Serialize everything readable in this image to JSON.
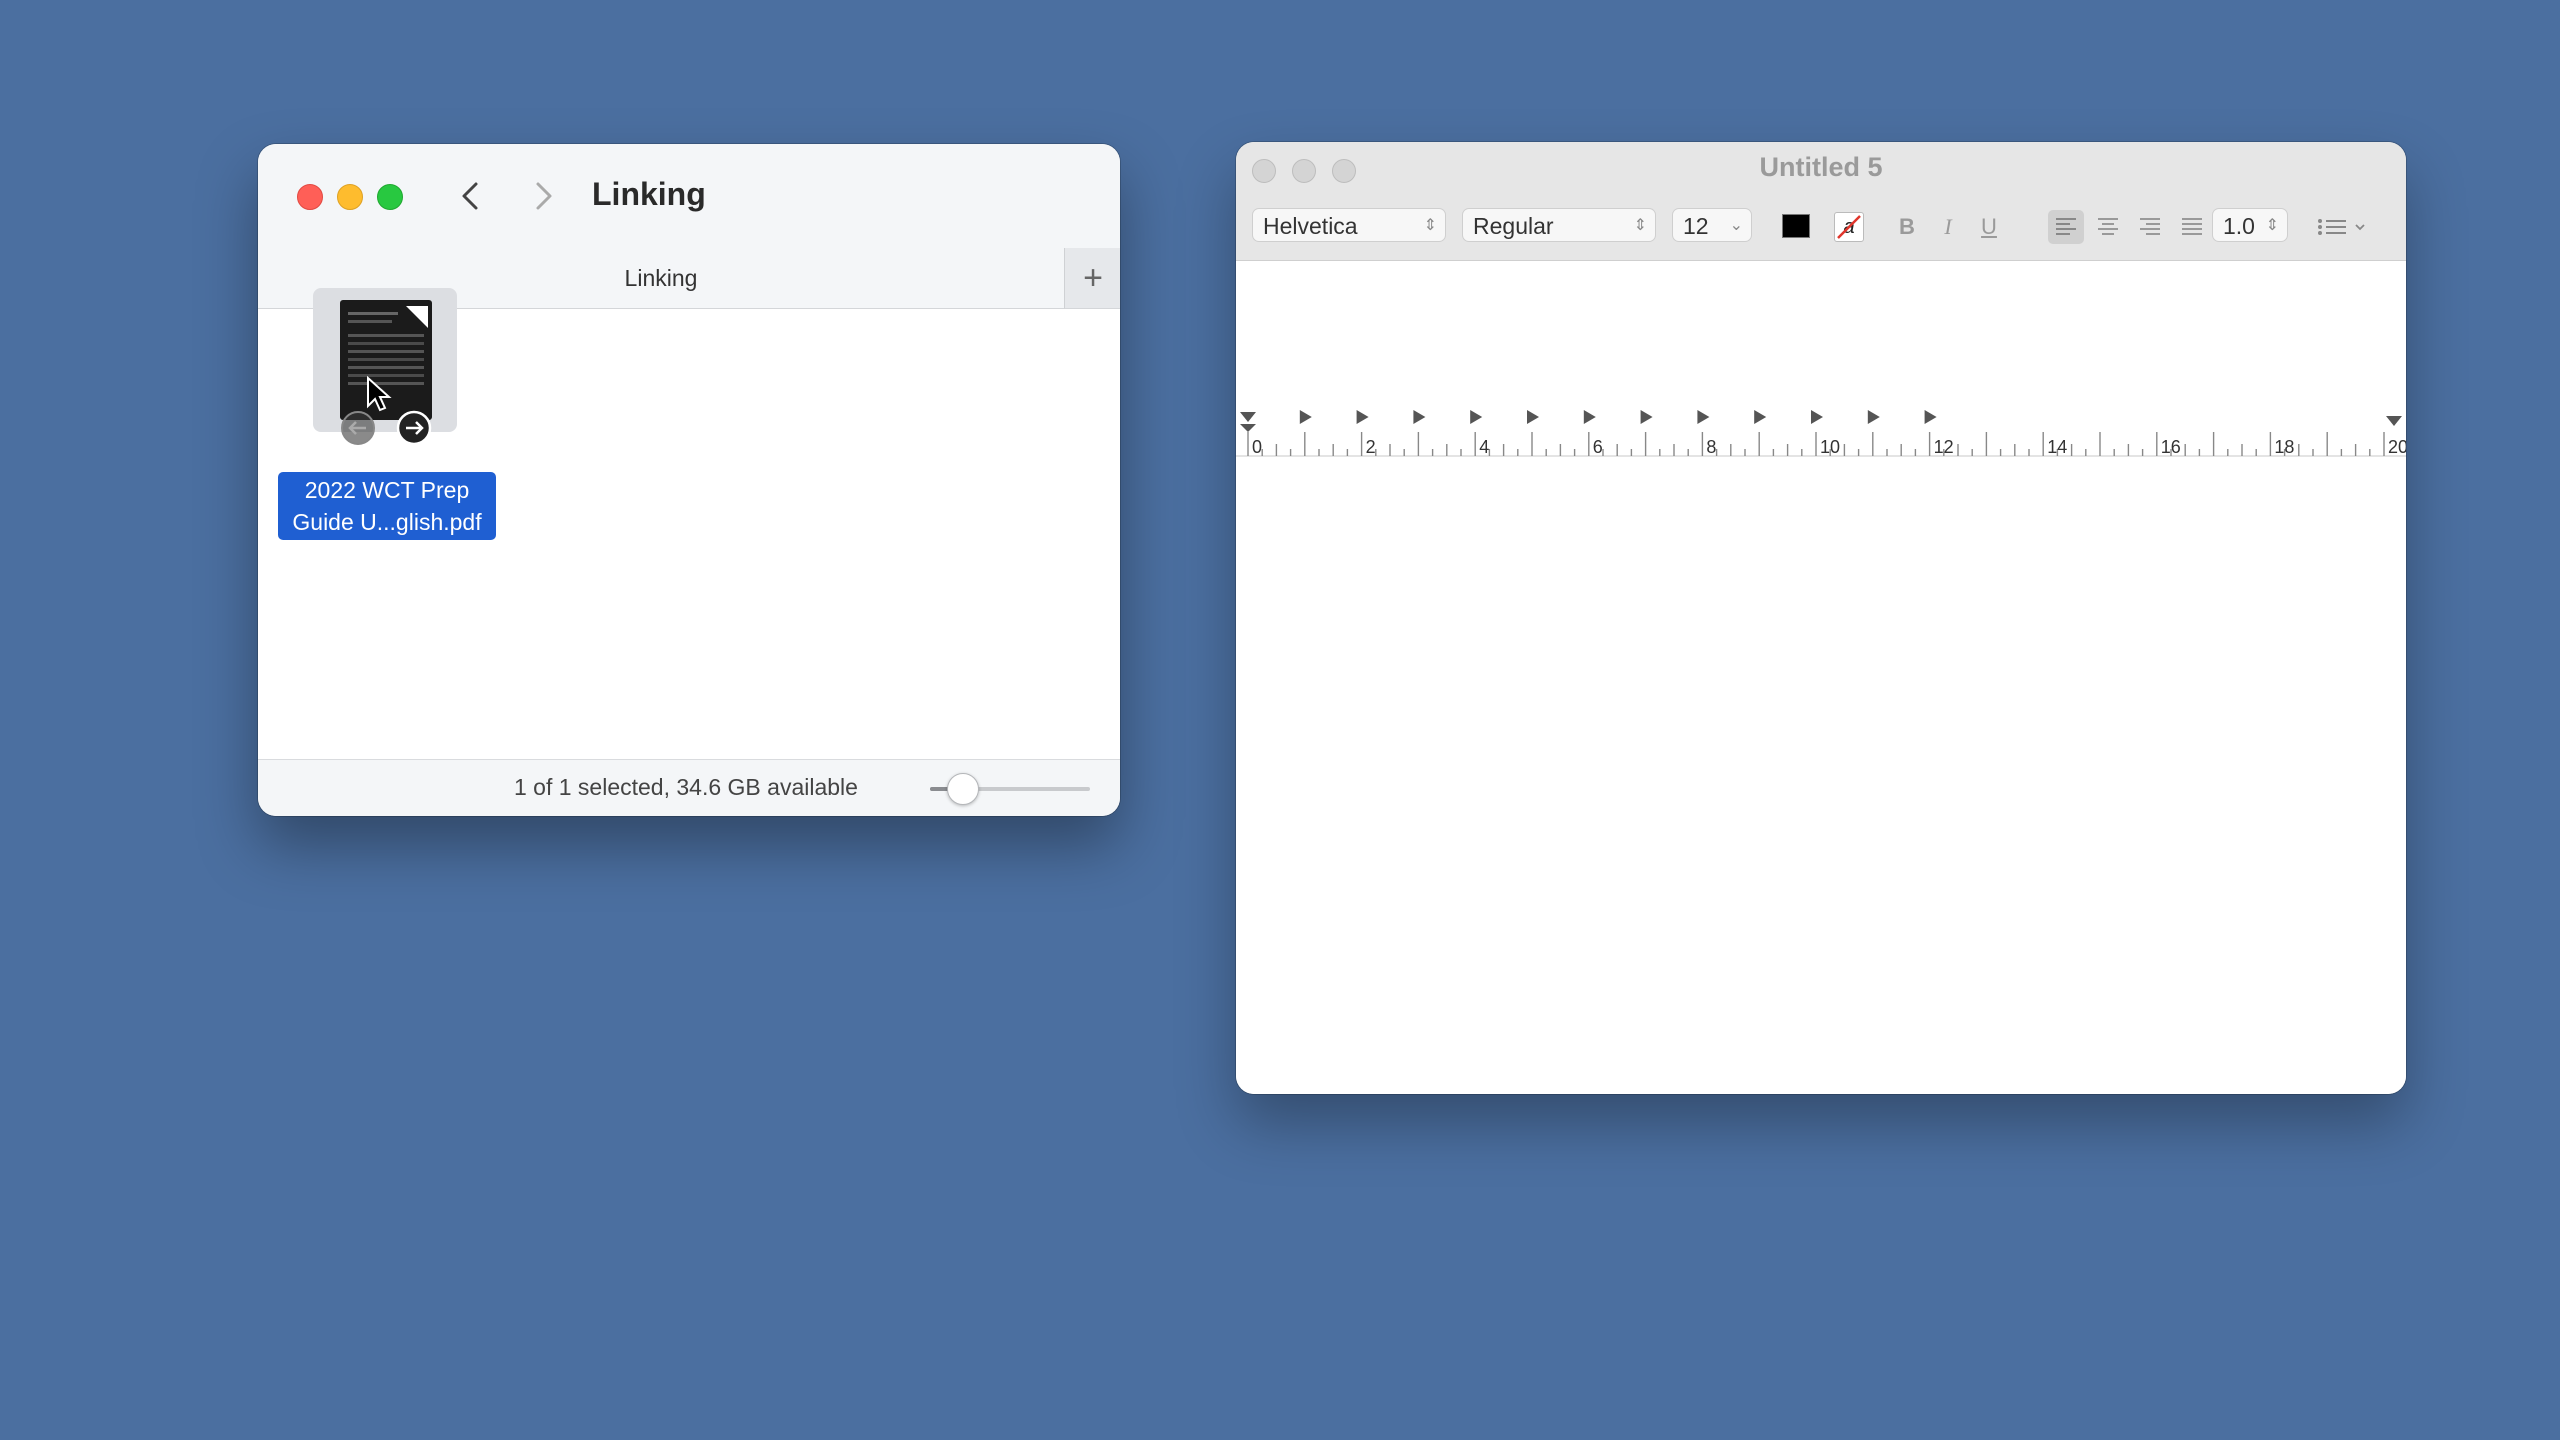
{
  "finder": {
    "title": "Linking",
    "tab_label": "Linking",
    "tab_add": "+",
    "file": {
      "name_line1": "2022 WCT Prep",
      "name_line2": "Guide U...glish.pdf"
    },
    "status": "1 of 1 selected, 34.6 GB available",
    "zoom_level": 0.2
  },
  "textedit": {
    "title": "Untitled 5",
    "font_family": "Helvetica",
    "font_style": "Regular",
    "font_size": "12",
    "text_color": "#000000",
    "bold": "B",
    "italic": "I",
    "underline": "U",
    "highlight_symbol": "a",
    "line_spacing": "1.0",
    "ruler_labels": [
      "0",
      "2",
      "4",
      "6",
      "8",
      "10",
      "12",
      "14",
      "16",
      "18",
      "20"
    ]
  },
  "colors": {
    "desktop": "#4b6fa0",
    "selection": "#1f5fd2"
  }
}
